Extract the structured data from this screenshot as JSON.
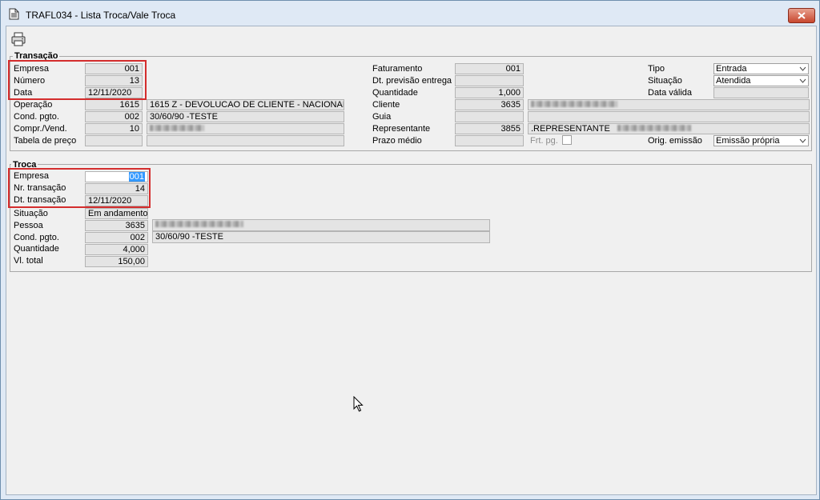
{
  "window": {
    "title": "TRAFL034 - Lista Troca/Vale Troca"
  },
  "transacao": {
    "group_title": "Transação",
    "empresa_label": "Empresa",
    "empresa_value": "001",
    "numero_label": "Número",
    "numero_value": "13",
    "data_label": "Data",
    "data_value": "12/11/2020",
    "operacao_label": "Operação",
    "operacao_code": "1615",
    "operacao_desc": "1615 Z - DEVOLUCAO DE CLIENTE - NACIONAL",
    "cond_pgto_label": "Cond. pgto.",
    "cond_pgto_code": "002",
    "cond_pgto_desc": "30/60/90 -TESTE",
    "compr_vend_label": "Compr./Vend.",
    "compr_vend_code": "10",
    "tabela_preco_label": "Tabela de preço",
    "faturamento_label": "Faturamento",
    "faturamento_value": "001",
    "dt_previsao_label": "Dt. previsão entrega",
    "quantidade_label": "Quantidade",
    "quantidade_value": "1,000",
    "cliente_label": "Cliente",
    "cliente_code": "3635",
    "guia_label": "Guia",
    "representante_label": "Representante",
    "representante_code": "3855",
    "representante_desc": ".REPRESENTANTE",
    "prazo_medio_label": "Prazo médio",
    "frt_pg_label": "Frt. pg.",
    "tipo_label": "Tipo",
    "tipo_value": "Entrada",
    "situacao_label": "Situação",
    "situacao_value": "Atendida",
    "data_valida_label": "Data válida",
    "orig_emissao_label": "Orig. emissão",
    "orig_emissao_value": "Emissão própria"
  },
  "troca": {
    "group_title": "Troca",
    "empresa_label": "Empresa",
    "empresa_value": "001",
    "nr_transacao_label": "Nr. transação",
    "nr_transacao_value": "14",
    "dt_transacao_label": "Dt. transação",
    "dt_transacao_value": "12/11/2020",
    "situacao_label": "Situação",
    "situacao_value": "Em andamento",
    "pessoa_label": "Pessoa",
    "pessoa_code": "3635",
    "cond_pgto_label": "Cond. pgto.",
    "cond_pgto_code": "002",
    "cond_pgto_desc": "30/60/90 -TESTE",
    "quantidade_label": "Quantidade",
    "quantidade_value": "4,000",
    "vl_total_label": "Vl. total",
    "vl_total_value": "150,00"
  },
  "icons": {
    "title": "document-icon",
    "close": "close-icon",
    "print": "printer-icon",
    "dropdown": "chevron-down-icon"
  },
  "colors": {
    "highlight": "#d42d2d",
    "selection": "#3399ff",
    "close_button": "#c8472e"
  }
}
